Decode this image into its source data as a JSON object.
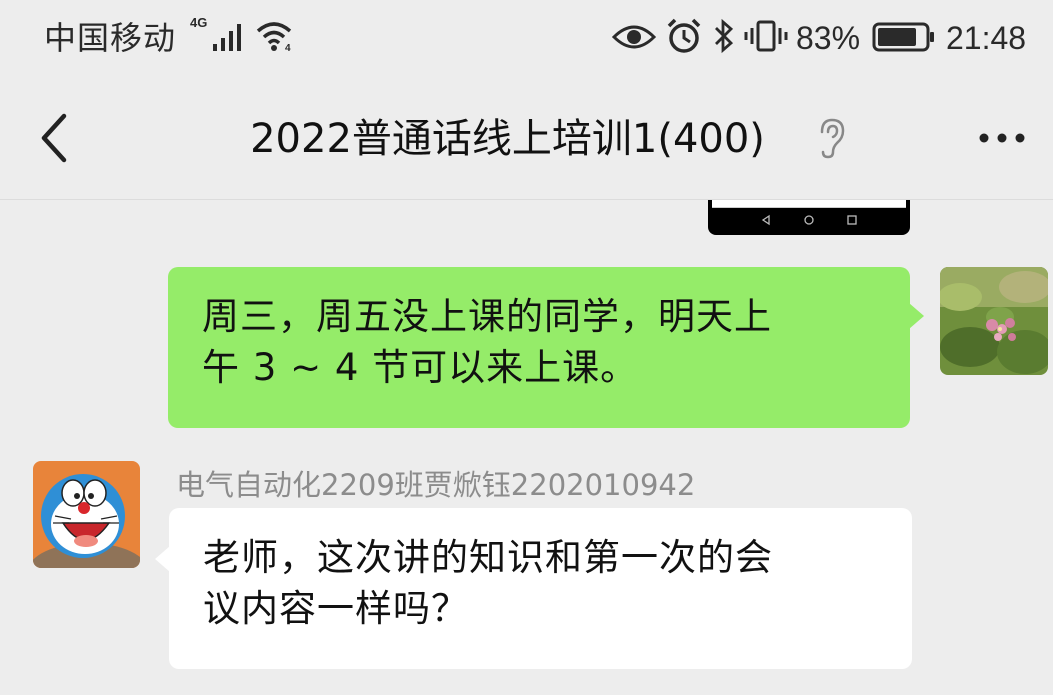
{
  "status_bar": {
    "carrier": "中国移动",
    "network_type": "4G",
    "battery_percent": "83%",
    "time": "21:48",
    "icons": [
      "signal-icon",
      "wifi-icon",
      "eye-icon",
      "alarm-icon",
      "bluetooth-icon",
      "vibrate-icon",
      "battery-icon"
    ],
    "battery_level": 0.83
  },
  "header": {
    "title": "2022普通话线上培训1(400)",
    "back_icon": "chevron-left-icon",
    "earpiece_icon": "ear-icon",
    "more_icon": "more-dots-icon"
  },
  "messages": [
    {
      "type": "image",
      "direction": "sent",
      "note_icons": [
        "nav-back-icon",
        "nav-home-icon",
        "nav-recent-icon"
      ]
    },
    {
      "type": "text",
      "direction": "sent",
      "lines": [
        "周三，周五没上课的同学，明天上",
        "午 3 ~ 4 节可以来上课。"
      ],
      "avatar": "flower-avatar",
      "bubble_color": "#95ec69"
    },
    {
      "type": "text",
      "direction": "received",
      "sender": "电气自动化2209班贾焮钰2202010942",
      "lines": [
        "老师，这次讲的知识和第一次的会",
        "议内容一样吗？"
      ],
      "avatar": "doraemon-avatar",
      "bubble_color": "#ffffff"
    }
  ],
  "colors": {
    "background": "#ededed",
    "sent_bubble": "#95ec69",
    "received_bubble": "#ffffff",
    "sender_name": "#8c8c8c"
  }
}
